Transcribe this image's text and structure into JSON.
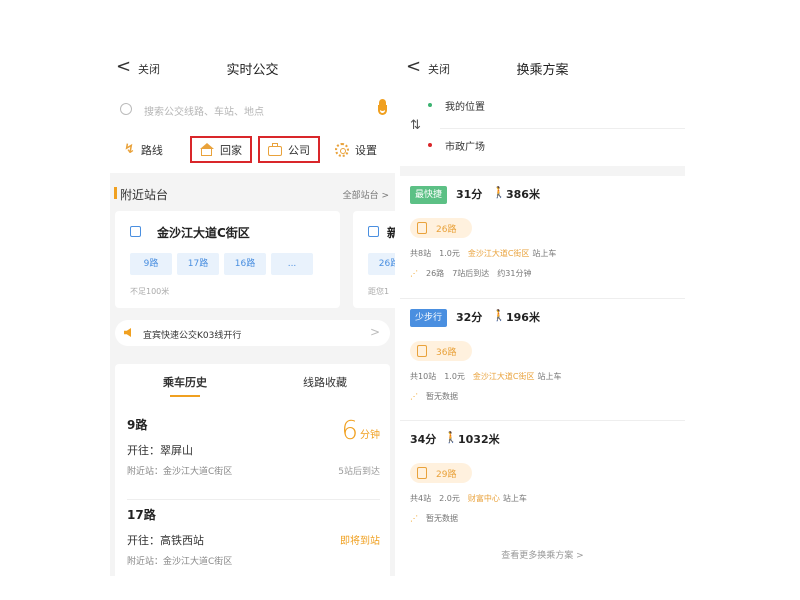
{
  "left": {
    "nav": {
      "back": "<",
      "close": "关闭",
      "title": "实时公交"
    },
    "search": {
      "placeholder": "搜索公交线路、车站、地点"
    },
    "quick": {
      "route": "路线",
      "home": "回家",
      "company": "公司",
      "settings": "设置"
    },
    "nearby": {
      "title": "附近站台",
      "all_label": "全部站台 >",
      "stations": [
        {
          "name": "金沙江大道C街区",
          "chips": [
            "9路",
            "17路",
            "16路",
            "..."
          ],
          "distance": "不足100米"
        },
        {
          "name": "新",
          "chips": [
            "26路"
          ],
          "distance": "距您1"
        }
      ]
    },
    "notice": {
      "text": "宜宾快速公交K03线开行",
      "arrow": ">"
    },
    "history": {
      "tabs": [
        "乘车历史",
        "线路收藏"
      ],
      "routes": [
        {
          "name": "9路",
          "dest": "开往：翠屏山",
          "near": "附近站：金沙江大道C街区",
          "minutes": "6",
          "unit": "分钟",
          "stops_after": "5站后到达"
        },
        {
          "name": "17路",
          "dest": "开往：高铁西站",
          "near": "附近站：金沙江大道C街区",
          "status": "即将到站"
        }
      ]
    }
  },
  "right": {
    "nav": {
      "back": "<",
      "close": "关闭",
      "title": "换乘方案"
    },
    "locations": {
      "swap": "⇅",
      "from": "我的位置",
      "to": "市政广场"
    },
    "plans": [
      {
        "tag": "最快捷",
        "time": "31分",
        "walk": "386米",
        "bus": "26路",
        "stations": "共8站",
        "fare": "1.0元",
        "board": "金沙江大道C街区",
        "board_suffix": "站上车",
        "rt_route": "26路",
        "rt_arrive": "7站后到达",
        "rt_eta": "约31分钟"
      },
      {
        "tag": "少步行",
        "time": "32分",
        "walk": "196米",
        "bus": "36路",
        "stations": "共10站",
        "fare": "1.0元",
        "board": "金沙江大道C街区",
        "board_suffix": "站上车",
        "rt_none": "暂无数据"
      },
      {
        "time": "34分",
        "walk": "1032米",
        "bus": "29路",
        "stations": "共4站",
        "fare": "2.0元",
        "board": "财富中心",
        "board_suffix": "站上车",
        "rt_none": "暂无数据"
      }
    ],
    "more": "查看更多换乘方案 >"
  },
  "colors": {
    "accent": "#f0a020",
    "blue": "#4a8fe0",
    "green": "#5cc085",
    "highlight_box": "#d9262a"
  }
}
